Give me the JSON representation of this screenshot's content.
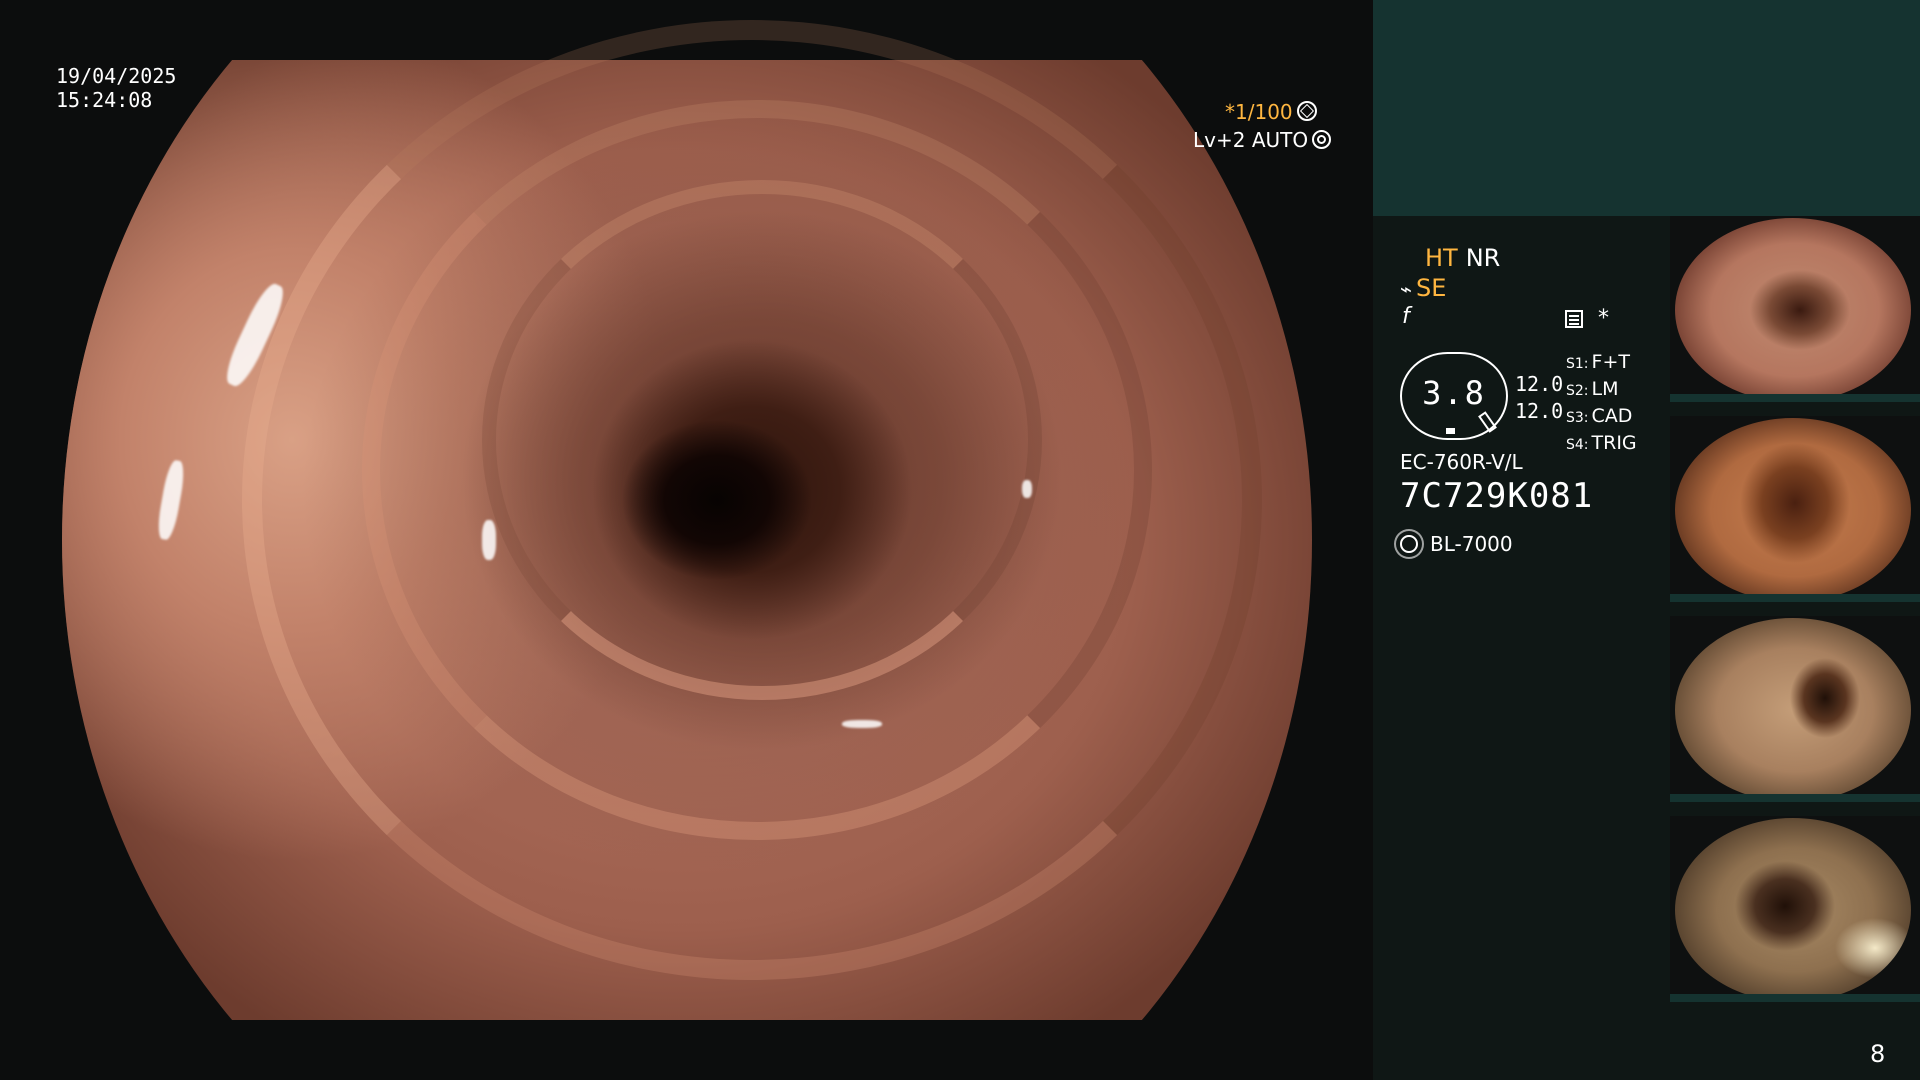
{
  "overlay": {
    "date": "19/04/2025",
    "time": "15:24:08",
    "shutter": "*1/100",
    "level": "Lv+2 AUTO"
  },
  "panel": {
    "ht": "HT",
    "nr": "NR",
    "se": "SE",
    "f_icon": "f",
    "star": "*",
    "gauge_value": "3.8",
    "gauge_left_top": "12.0",
    "gauge_left_bottom": "12.0",
    "s_items": [
      {
        "key": "S1:",
        "value": "F+T"
      },
      {
        "key": "S2:",
        "value": "LM"
      },
      {
        "key": "S3:",
        "value": "CAD"
      },
      {
        "key": "S4:",
        "value": "TRIG"
      }
    ],
    "model": "EC-760R-V/L",
    "serial": "7C729K081",
    "light_source": "BL-7000"
  },
  "page_number": "8",
  "colors": {
    "accent_orange": "#ffb640",
    "panel_header": "#153330",
    "panel_bg": "#0f1715"
  },
  "icons": [
    "shutter-icon",
    "auto-icon",
    "scope-icon",
    "menu-icon",
    "light-source-icon",
    "pen-icon"
  ]
}
